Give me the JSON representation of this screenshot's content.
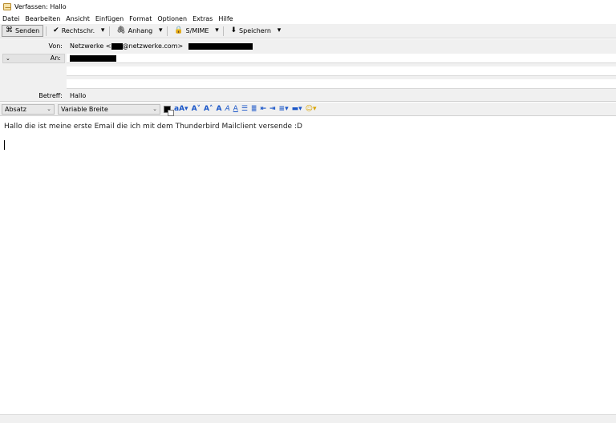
{
  "window": {
    "title": "Verfassen: Hallo"
  },
  "menu": [
    "Datei",
    "Bearbeiten",
    "Ansicht",
    "Einfügen",
    "Format",
    "Optionen",
    "Extras",
    "Hilfe"
  ],
  "toolbar": {
    "send": "Senden",
    "spell": "Rechtschr.",
    "attach": "Anhang",
    "smime": "S/MIME",
    "save": "Speichern"
  },
  "headers": {
    "from_label": "Von:",
    "from_name": "Netzwerke <",
    "from_domain": "@netzwerke.com>",
    "to_label": "An:",
    "subject_label": "Betreff:",
    "subject_value": "Hallo"
  },
  "format": {
    "paragraph": "Absatz",
    "font": "Variable Breite"
  },
  "body": {
    "text": "Hallo die ist meine erste Email die ich mit dem Thunderbird Mailclient versende :D"
  }
}
